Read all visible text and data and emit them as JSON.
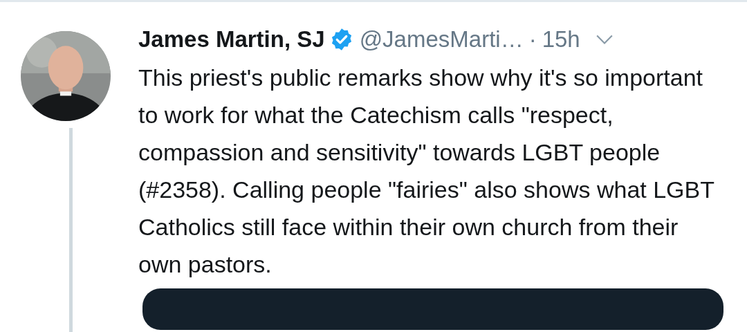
{
  "tweet": {
    "author_name": "James Martin, SJ",
    "verified": true,
    "handle": "@JamesMarti…",
    "separator": "·",
    "time": "15h",
    "text": "This priest's public remarks show why it's so important to work for what the Catechism calls \"respect, compassion and sensitivity\" towards LGBT people (#2358). Calling people \"fairies\" also shows what LGBT Catholics still face within their own church from their own pastors."
  }
}
